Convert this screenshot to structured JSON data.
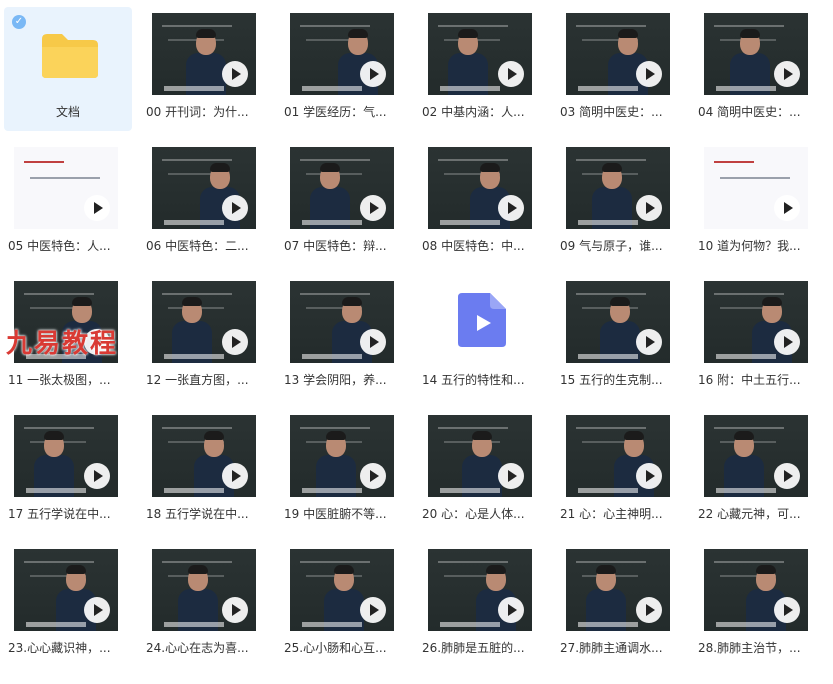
{
  "folder": {
    "name": "文档"
  },
  "files": [
    "00 开刊词：为什...",
    "01 学医经历：气...",
    "02 中基内涵：人...",
    "03 简明中医史：...",
    "04 简明中医史：...",
    "05 中医特色：人...",
    "06 中医特色：二...",
    "07 中医特色：辩...",
    "08 中医特色：中...",
    "09 气与原子，谁...",
    "10 道为何物？我...",
    "11 一张太极图，...",
    "12 一张直方图，...",
    "13 学会阴阳，养...",
    "14 五行的特性和...",
    "15 五行的生克制...",
    "16 附：中土五行...",
    "17 五行学说在中...",
    "18 五行学说在中...",
    "19 中医脏腑不等...",
    "20 心：心是人体...",
    "21 心：心主神明...",
    "22 心藏元神，可...",
    "23.心心藏识神，...",
    "24.心心在志为喜...",
    "25.心小肠和心互...",
    "26.肺肺是五脏的...",
    "27.肺肺主通调水...",
    "28.肺肺主治节，..."
  ],
  "watermark": "九易教程",
  "icons": {
    "folder": "folder-icon",
    "video": "video-file-icon",
    "play": "play-icon",
    "check": "check-icon"
  },
  "colors": {
    "selected_bg": "#e9f3fd",
    "folder": "#f7c948",
    "video_icon": "#6b7cf0",
    "watermark": "#d93a34"
  }
}
